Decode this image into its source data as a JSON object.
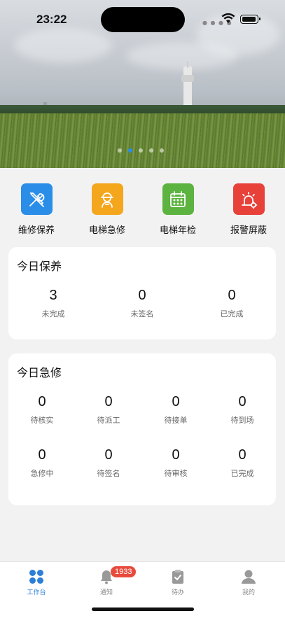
{
  "status": {
    "time": "23:22"
  },
  "banner": {
    "slide_count": 5,
    "active_slide": 1
  },
  "quick_actions": [
    {
      "label": "维修保养",
      "color": "#2a8de8",
      "icon": "wrench-screwdriver-icon"
    },
    {
      "label": "电梯急修",
      "color": "#f4a61d",
      "icon": "worker-icon"
    },
    {
      "label": "电梯年检",
      "color": "#5cb33f",
      "icon": "calendar-icon"
    },
    {
      "label": "报警屏蔽",
      "color": "#e8413a",
      "icon": "alarm-gear-icon"
    }
  ],
  "maintenance": {
    "title": "今日保养",
    "stats": [
      {
        "value": "3",
        "label": "未完成"
      },
      {
        "value": "0",
        "label": "未签名"
      },
      {
        "value": "0",
        "label": "已完成"
      }
    ]
  },
  "repair": {
    "title": "今日急修",
    "stats": [
      {
        "value": "0",
        "label": "待核实"
      },
      {
        "value": "0",
        "label": "待派工"
      },
      {
        "value": "0",
        "label": "待接单"
      },
      {
        "value": "0",
        "label": "待到场"
      },
      {
        "value": "0",
        "label": "急修中"
      },
      {
        "value": "0",
        "label": "待签名"
      },
      {
        "value": "0",
        "label": "待审核"
      },
      {
        "value": "0",
        "label": "已完成"
      }
    ]
  },
  "tabs": [
    {
      "label": "工作台",
      "active": true
    },
    {
      "label": "通知",
      "badge": "1933"
    },
    {
      "label": "待办"
    },
    {
      "label": "我的"
    }
  ],
  "colors": {
    "accent": "#2b7fd6",
    "badge": "#e84b3c"
  }
}
